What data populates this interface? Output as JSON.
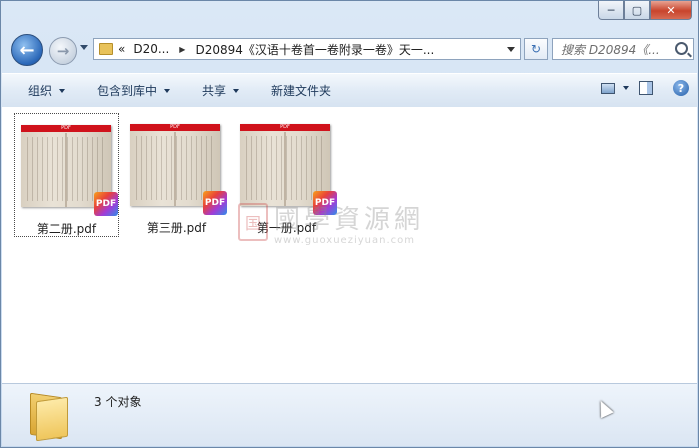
{
  "window": {
    "min_label": "─",
    "max_label": "▢",
    "close_label": "✕"
  },
  "nav": {
    "back_glyph": "←",
    "forward_glyph": "→",
    "breadcrumb": [
      {
        "label": "«"
      },
      {
        "label": "D20..."
      },
      {
        "label": "D20894《汉语十卷首一卷附录一卷》天一..."
      }
    ],
    "refresh_glyph": "↻",
    "search_placeholder": "搜索 D20894《..."
  },
  "toolbar": {
    "organize": "组织",
    "include_library": "包含到库中",
    "share": "共享",
    "new_folder": "新建文件夹",
    "help": "?"
  },
  "files": [
    {
      "name": "第二册.pdf",
      "selected": true,
      "badge": "PDF",
      "bar": "PDF"
    },
    {
      "name": "第三册.pdf",
      "selected": false,
      "badge": "PDF",
      "bar": "PDF"
    },
    {
      "name": "第一册.pdf",
      "selected": false,
      "badge": "PDF",
      "bar": "PDF"
    }
  ],
  "watermark": {
    "seal": "国",
    "title": "國學資源網",
    "url": "www.guoxueziyuan.com"
  },
  "status": {
    "count_text": "3 个对象"
  }
}
